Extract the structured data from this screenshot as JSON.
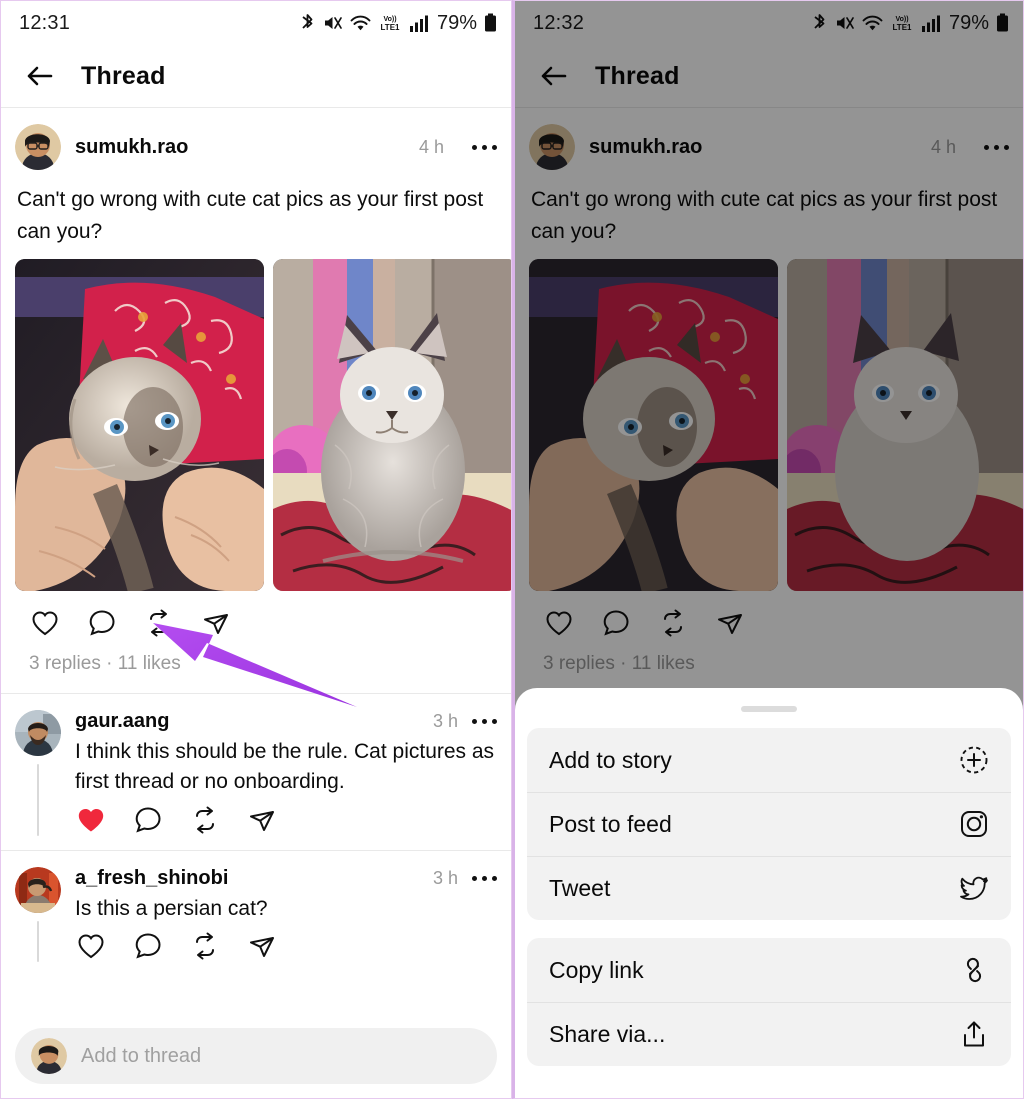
{
  "status_bar": {
    "left_time": "12:31",
    "right_time": "12:32",
    "battery": "79%",
    "icons": [
      "bluetooth-icon",
      "mute-icon",
      "wifi-icon",
      "volte-icon",
      "signal-icon",
      "battery-icon"
    ]
  },
  "app_bar": {
    "title": "Thread",
    "back_label": "back-arrow"
  },
  "post": {
    "username": "sumukh.rao",
    "timestamp": "4 h",
    "text": "Can't go wrong with cute cat pics as your first post can you?",
    "meta": "3 replies · 11 likes",
    "actions": [
      "like",
      "comment",
      "repost",
      "share"
    ],
    "media": [
      {
        "alt": "kitten held in hands on pink paisley cloth"
      },
      {
        "alt": "fluffy kitten sitting on patterned carpet"
      }
    ]
  },
  "replies": [
    {
      "username": "gaur.aang",
      "timestamp": "3 h",
      "text": "I think this should be the rule. Cat pictures as first thread or no onboarding.",
      "liked": true
    },
    {
      "username": "a_fresh_shinobi",
      "timestamp": "3 h",
      "text": "Is this a persian cat?",
      "liked": false
    }
  ],
  "composer": {
    "placeholder": "Add to thread"
  },
  "share_sheet": {
    "groups": [
      {
        "items": [
          {
            "label": "Add to story",
            "icon": "add-to-story-icon"
          },
          {
            "label": "Post to feed",
            "icon": "instagram-icon"
          },
          {
            "label": "Tweet",
            "icon": "twitter-icon"
          }
        ]
      },
      {
        "items": [
          {
            "label": "Copy link",
            "icon": "link-icon"
          },
          {
            "label": "Share via...",
            "icon": "share-upload-icon"
          }
        ]
      }
    ]
  },
  "annotations": {
    "arrow_color": "#a63fe8",
    "left_arrow_target": "share-button",
    "right_arrow_target": "Add to story"
  },
  "colors": {
    "accent_purple": "#a63fe8",
    "heart_red": "#f0283c",
    "panel_border": "#d9b3e8",
    "dim_overlay": "#000000"
  }
}
